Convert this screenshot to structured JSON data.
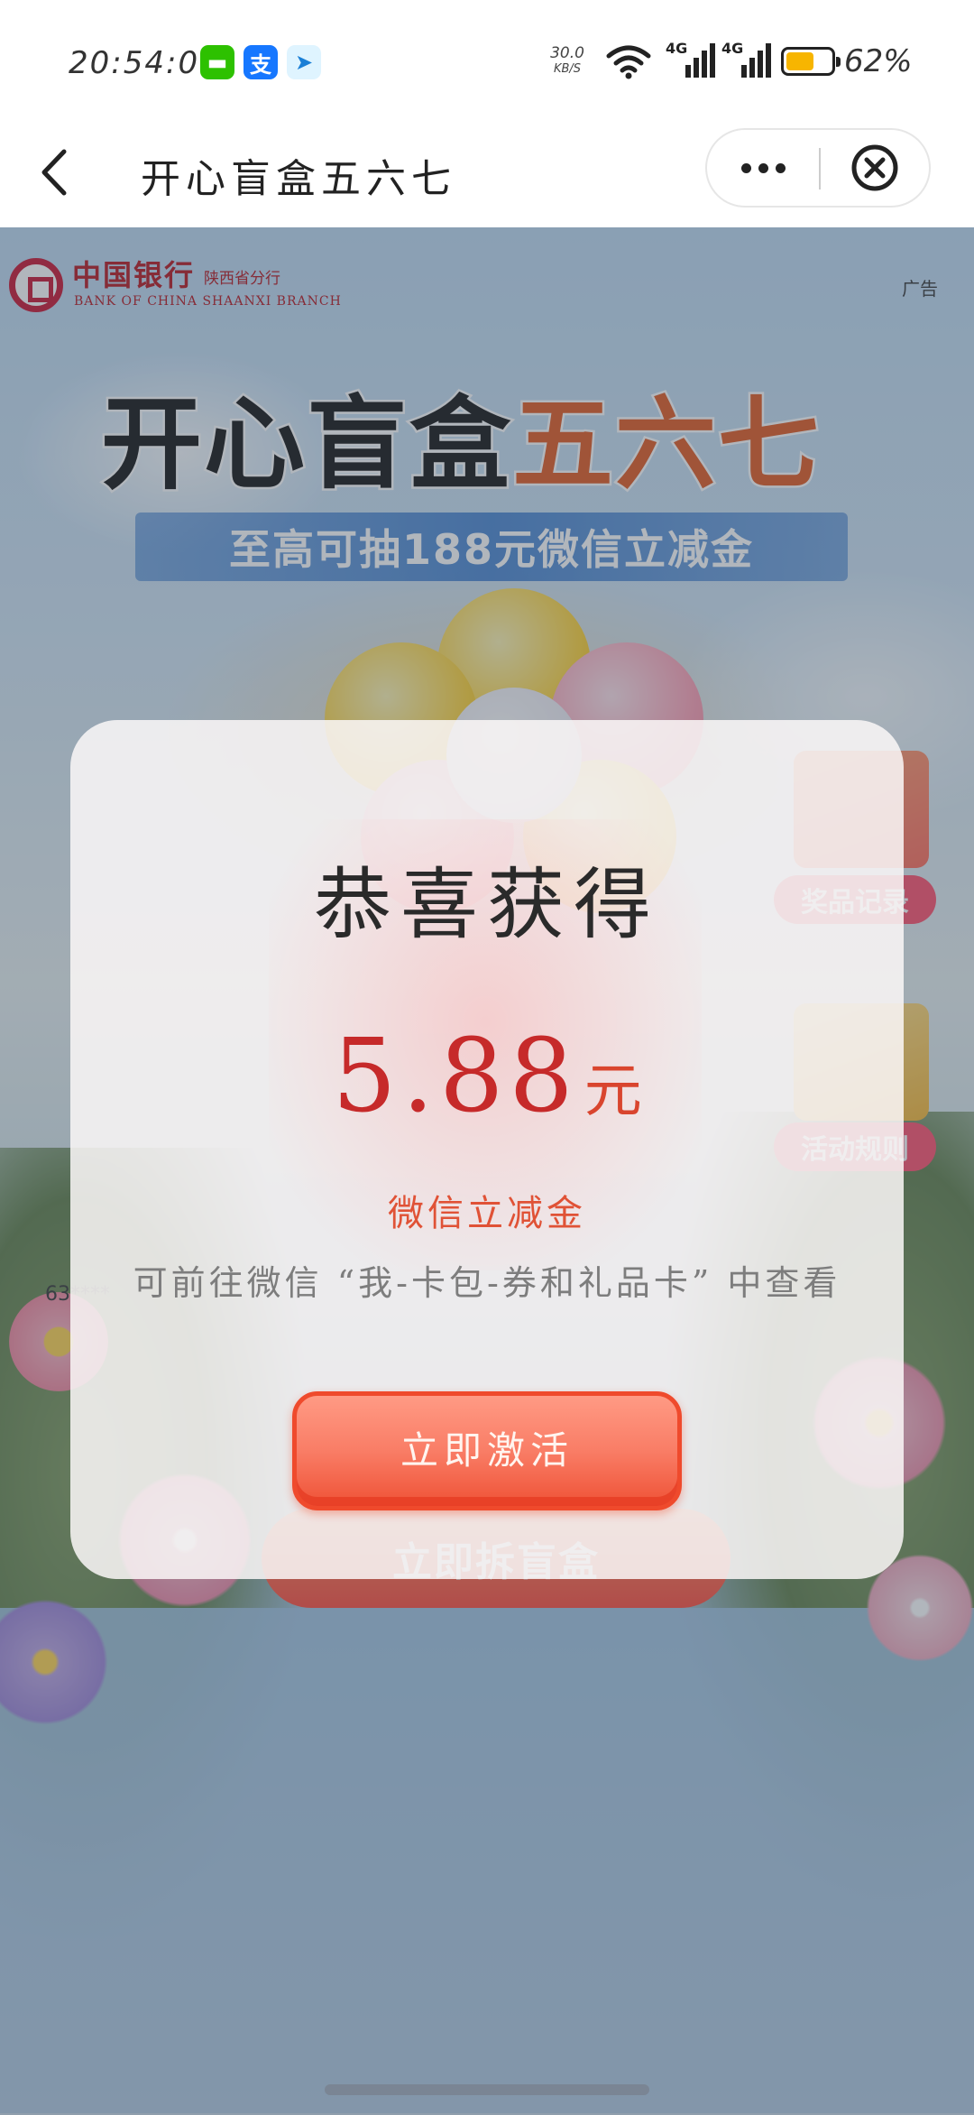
{
  "status_bar": {
    "time": "20:54:01",
    "notification_icons": [
      "wechat-icon",
      "alipay-icon",
      "send-icon"
    ],
    "network_speed_value": "30.0",
    "network_speed_unit": "KB/S",
    "signal_1_label": "4G",
    "signal_2_label": "4G",
    "battery_level": 0.62,
    "battery_percent": "62%"
  },
  "nav": {
    "title": "开心盲盒五六七",
    "back_icon": "chevron-left-icon",
    "more_icon": "more-dots-icon",
    "close_icon": "close-circle-icon"
  },
  "banner": {
    "bank_name": "中国银行",
    "bank_branch": "陕西省分行",
    "bank_english": "BANK OF CHINA SHAANXI BRANCH",
    "ad_label": "广告",
    "title_black": "开心盲盒",
    "title_orange": "五六七",
    "subtitle": "至高可抽188元微信立减金",
    "prize_record_button": "奖品记录",
    "activity_rules_button": "活动规则",
    "user_masked": "63****",
    "open_box_button": "立即拆盲盒"
  },
  "modal": {
    "title": "恭喜获得",
    "amount": "5.88",
    "unit": "元",
    "reward_type": "微信立减金",
    "description": "可前往微信 “我-卡包-券和礼品卡” 中查看",
    "activate_button": "立即激活"
  },
  "colors": {
    "accent_red": "#c62a2a",
    "button_red": "#ef5236",
    "bank_red": "#b5121b",
    "title_orange": "#e2561c",
    "battery_yellow": "#f7b500"
  }
}
